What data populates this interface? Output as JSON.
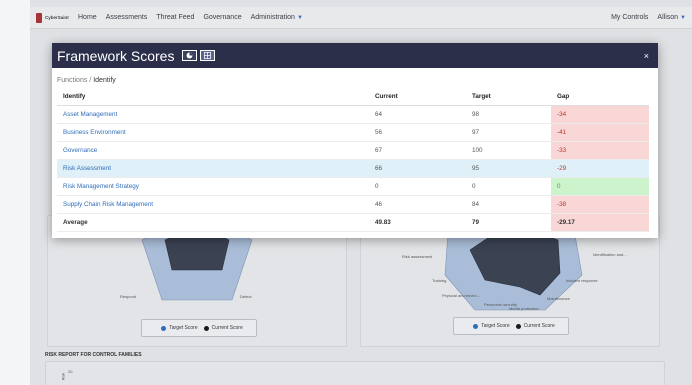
{
  "nav": {
    "brand": "CyberSaint",
    "items": [
      "Home",
      "Assessments",
      "Threat Feed",
      "Governance",
      "Administration"
    ],
    "right": [
      "My Controls",
      "Allison"
    ]
  },
  "modal": {
    "title": "Framework Scores",
    "close": "×",
    "breadcrumb_parent": "Functions",
    "breadcrumb_sep": "/",
    "breadcrumb_current": "Identify",
    "columns": [
      "Identify",
      "Current",
      "Target",
      "Gap"
    ],
    "rows": [
      {
        "name": "Asset Management",
        "current": "64",
        "target": "98",
        "gap": "-34"
      },
      {
        "name": "Business Environment",
        "current": "56",
        "target": "97",
        "gap": "-41"
      },
      {
        "name": "Governance",
        "current": "67",
        "target": "100",
        "gap": "-33"
      },
      {
        "name": "Risk Assessment",
        "current": "66",
        "target": "95",
        "gap": "-29"
      },
      {
        "name": "Risk Management Strategy",
        "current": "0",
        "target": "0",
        "gap": "0"
      },
      {
        "name": "Supply Chain Risk Management",
        "current": "46",
        "target": "84",
        "gap": "-38"
      }
    ],
    "average": {
      "label": "Average",
      "current": "49.83",
      "target": "79",
      "gap": "-29.17"
    }
  },
  "background": {
    "left_radar_labels": [
      "Respond",
      "Detect"
    ],
    "right_radar_labels": [
      "Risk assessment",
      "Identification and...",
      "Training",
      "Incident response",
      "Physical and enviro...",
      "Maintenance",
      "Personnel security",
      "Media protection"
    ],
    "legend": {
      "target": "Target Score",
      "current": "Current Score"
    },
    "report_title": "RISK REPORT FOR CONTROL FAMILIES",
    "axis_label": "Risk",
    "axis_tick": "20"
  },
  "colors": {
    "target": "#2f6db8",
    "current": "#1b1b1b",
    "header": "#2b2f49",
    "gap_negative": "#f9d7d7",
    "gap_positive": "#cdf3cd",
    "selected_row": "#dff0f8"
  }
}
